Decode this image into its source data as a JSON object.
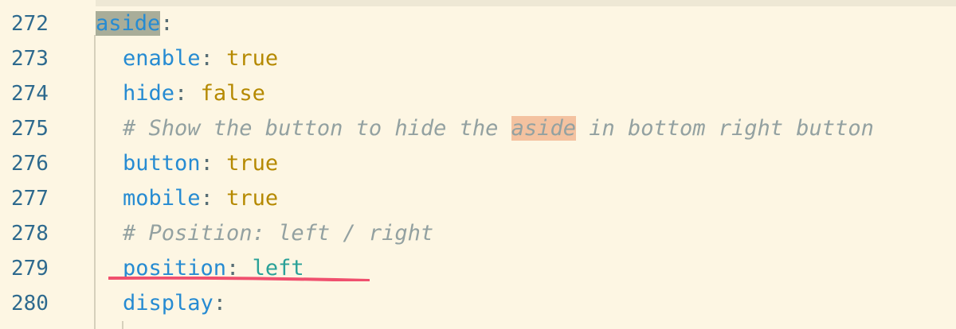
{
  "colors": {
    "background": "#fdf6e3",
    "line_number": "#2e6a8e",
    "key": "#268bd2",
    "value": "#b58900",
    "string": "#2aa198",
    "comment": "#93a1a1",
    "annotation_underline": "#f0506e"
  },
  "lines": [
    {
      "number": "272",
      "key": "aside",
      "colon": ":"
    },
    {
      "number": "273",
      "key": "enable",
      "colon": ":",
      "value": "true"
    },
    {
      "number": "274",
      "key": "hide",
      "colon": ":",
      "value": "false"
    },
    {
      "number": "275",
      "comment_before": "# Show the button to hide the ",
      "comment_match": "aside",
      "comment_after": " in bottom right button"
    },
    {
      "number": "276",
      "key": "button",
      "colon": ":",
      "value": "true"
    },
    {
      "number": "277",
      "key": "mobile",
      "colon": ":",
      "value": "true"
    },
    {
      "number": "278",
      "comment": "# Position: left / right"
    },
    {
      "number": "279",
      "key": "position",
      "colon": ":",
      "value": "left"
    },
    {
      "number": "280",
      "key": "display",
      "colon": ":"
    }
  ]
}
